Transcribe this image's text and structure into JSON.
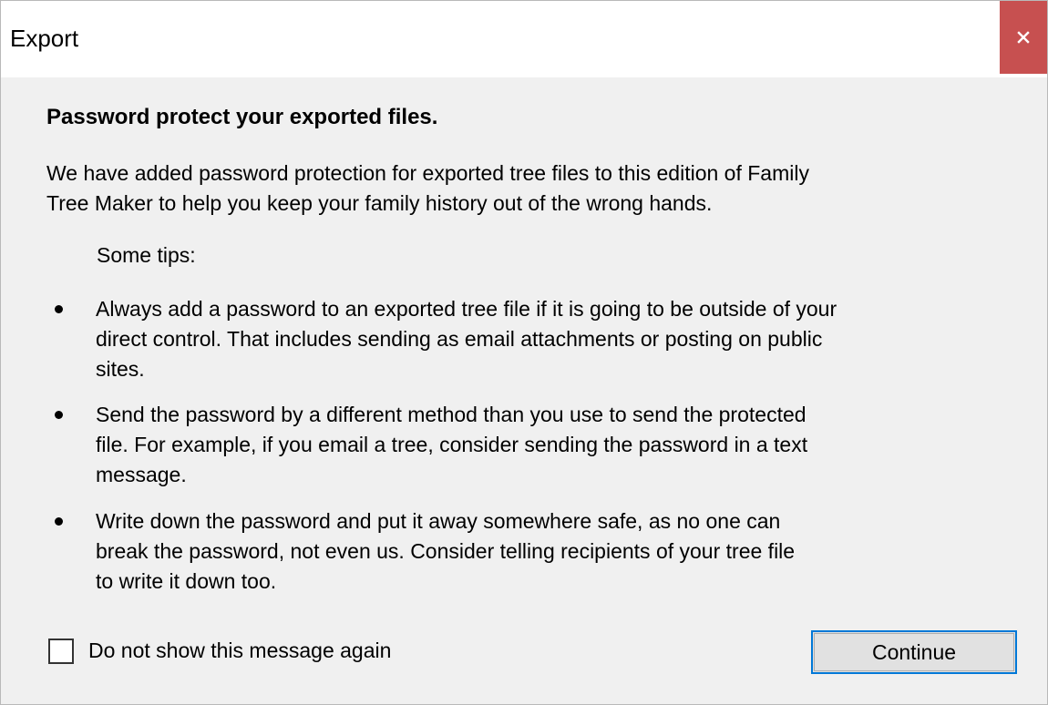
{
  "window": {
    "title": "Export",
    "close_symbol": "close-icon"
  },
  "dialog": {
    "heading": "Password protect your exported files.",
    "intro_line1": "We have added password protection for exported tree files to this edition of Family",
    "intro_line2": "Tree Maker to help you keep your family history out of the wrong hands.",
    "tips_label": "Some tips:",
    "tips": [
      {
        "line1": "Always add a password to an exported tree file if it is going to be outside of your",
        "line2": "direct control. That includes sending as email attachments or posting on public",
        "line3": "sites."
      },
      {
        "line1": "Send the password by a different method than you use to send the protected",
        "line2": "file. For example, if you email a tree, consider sending the password in a text",
        "line3": "message."
      },
      {
        "line1": "Write down the password and put it away somewhere safe, as no one can",
        "line2": "break the password, not even us. Consider telling recipients of your tree file",
        "line3": "to write it down too."
      }
    ],
    "checkbox_label": "Do not show this message again",
    "checkbox_checked": false,
    "continue_label": "Continue"
  },
  "colors": {
    "close_button_bg": "#c75050",
    "dialog_bg": "#f0f0f0",
    "button_focus_border": "#0078d7"
  }
}
